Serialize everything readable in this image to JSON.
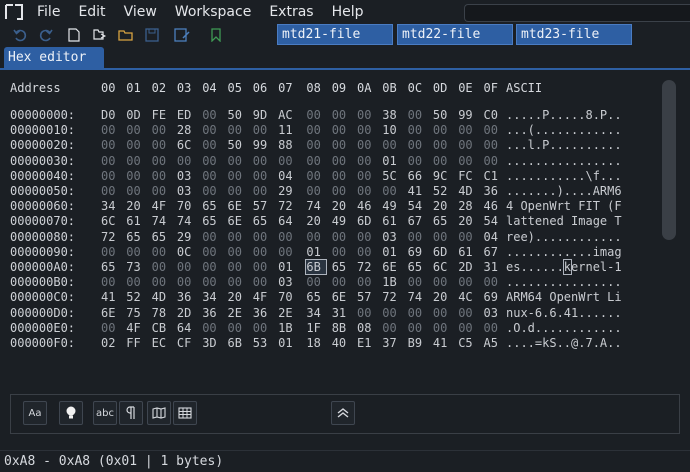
{
  "menu": [
    "File",
    "Edit",
    "View",
    "Workspace",
    "Extras",
    "Help"
  ],
  "toolbar_icons": [
    "undo-icon",
    "redo-icon",
    "new-file-icon",
    "open-folder-icon",
    "save-icon",
    "save-as-icon",
    "bookmark-icon"
  ],
  "file_tabs": [
    "mtd21-file",
    "mtd22-file",
    "mtd23-file"
  ],
  "editor_tab": "Hex editor",
  "hex": {
    "address_header": "Address",
    "ascii_header": "ASCII",
    "columns": [
      "00",
      "01",
      "02",
      "03",
      "04",
      "05",
      "06",
      "07",
      "08",
      "09",
      "0A",
      "0B",
      "0C",
      "0D",
      "0E",
      "0F"
    ],
    "selected": {
      "row": 10,
      "col": 8,
      "ascii_char_index": 8
    },
    "rows": [
      {
        "address": "00000000:",
        "bytes": [
          "D0",
          "0D",
          "FE",
          "ED",
          "00",
          "50",
          "9D",
          "AC",
          "00",
          "00",
          "00",
          "38",
          "00",
          "50",
          "99",
          "C0"
        ],
        "ascii": ".....P.....8.P.."
      },
      {
        "address": "00000010:",
        "bytes": [
          "00",
          "00",
          "00",
          "28",
          "00",
          "00",
          "00",
          "11",
          "00",
          "00",
          "00",
          "10",
          "00",
          "00",
          "00",
          "00"
        ],
        "ascii": "...(............"
      },
      {
        "address": "00000020:",
        "bytes": [
          "00",
          "00",
          "00",
          "6C",
          "00",
          "50",
          "99",
          "88",
          "00",
          "00",
          "00",
          "00",
          "00",
          "00",
          "00",
          "00"
        ],
        "ascii": "...l.P.........."
      },
      {
        "address": "00000030:",
        "bytes": [
          "00",
          "00",
          "00",
          "00",
          "00",
          "00",
          "00",
          "00",
          "00",
          "00",
          "00",
          "01",
          "00",
          "00",
          "00",
          "00"
        ],
        "ascii": "................"
      },
      {
        "address": "00000040:",
        "bytes": [
          "00",
          "00",
          "00",
          "03",
          "00",
          "00",
          "00",
          "04",
          "00",
          "00",
          "00",
          "5C",
          "66",
          "9C",
          "FC",
          "C1"
        ],
        "ascii": "...........\\f..."
      },
      {
        "address": "00000050:",
        "bytes": [
          "00",
          "00",
          "00",
          "03",
          "00",
          "00",
          "00",
          "29",
          "00",
          "00",
          "00",
          "00",
          "41",
          "52",
          "4D",
          "36"
        ],
        "ascii": ".......)....ARM6"
      },
      {
        "address": "00000060:",
        "bytes": [
          "34",
          "20",
          "4F",
          "70",
          "65",
          "6E",
          "57",
          "72",
          "74",
          "20",
          "46",
          "49",
          "54",
          "20",
          "28",
          "46"
        ],
        "ascii": "4 OpenWrt FIT (F"
      },
      {
        "address": "00000070:",
        "bytes": [
          "6C",
          "61",
          "74",
          "74",
          "65",
          "6E",
          "65",
          "64",
          "20",
          "49",
          "6D",
          "61",
          "67",
          "65",
          "20",
          "54"
        ],
        "ascii": "lattened Image T"
      },
      {
        "address": "00000080:",
        "bytes": [
          "72",
          "65",
          "65",
          "29",
          "00",
          "00",
          "00",
          "00",
          "00",
          "00",
          "00",
          "03",
          "00",
          "00",
          "00",
          "04"
        ],
        "ascii": "ree)............"
      },
      {
        "address": "00000090:",
        "bytes": [
          "00",
          "00",
          "00",
          "0C",
          "00",
          "00",
          "00",
          "00",
          "01",
          "00",
          "00",
          "01",
          "69",
          "6D",
          "61",
          "67"
        ],
        "ascii": "............imag"
      },
      {
        "address": "000000A0:",
        "bytes": [
          "65",
          "73",
          "00",
          "00",
          "00",
          "00",
          "00",
          "01",
          "6B",
          "65",
          "72",
          "6E",
          "65",
          "6C",
          "2D",
          "31"
        ],
        "ascii": "es......kernel-1"
      },
      {
        "address": "000000B0:",
        "bytes": [
          "00",
          "00",
          "00",
          "00",
          "00",
          "00",
          "00",
          "03",
          "00",
          "00",
          "00",
          "1B",
          "00",
          "00",
          "00",
          "00"
        ],
        "ascii": "................"
      },
      {
        "address": "000000C0:",
        "bytes": [
          "41",
          "52",
          "4D",
          "36",
          "34",
          "20",
          "4F",
          "70",
          "65",
          "6E",
          "57",
          "72",
          "74",
          "20",
          "4C",
          "69"
        ],
        "ascii": "ARM64 OpenWrt Li"
      },
      {
        "address": "000000D0:",
        "bytes": [
          "6E",
          "75",
          "78",
          "2D",
          "36",
          "2E",
          "36",
          "2E",
          "34",
          "31",
          "00",
          "00",
          "00",
          "00",
          "00",
          "03"
        ],
        "ascii": "nux-6.6.41......"
      },
      {
        "address": "000000E0:",
        "bytes": [
          "00",
          "4F",
          "CB",
          "64",
          "00",
          "00",
          "00",
          "1B",
          "1F",
          "8B",
          "08",
          "00",
          "00",
          "00",
          "00",
          "00"
        ],
        "ascii": ".O.d............"
      },
      {
        "address": "000000F0:",
        "bytes": [
          "02",
          "FF",
          "EC",
          "CF",
          "3D",
          "6B",
          "53",
          "01",
          "18",
          "40",
          "E1",
          "37",
          "B9",
          "41",
          "C5",
          "A5"
        ],
        "ascii": "....=kS..@.7.A.."
      }
    ]
  },
  "tools": [
    {
      "name": "font-size-tool",
      "label": "Aa"
    },
    {
      "name": "highlight-tool",
      "icon": "lightbulb-icon"
    },
    {
      "name": "spellcheck-tool",
      "label": "abc"
    },
    {
      "name": "pilcrow-tool",
      "icon": "pilcrow-icon"
    },
    {
      "name": "map-tool",
      "icon": "map-icon"
    },
    {
      "name": "table-tool",
      "icon": "table-icon"
    }
  ],
  "status": "0xA8 - 0xA8 (0x01 | 1 bytes)"
}
